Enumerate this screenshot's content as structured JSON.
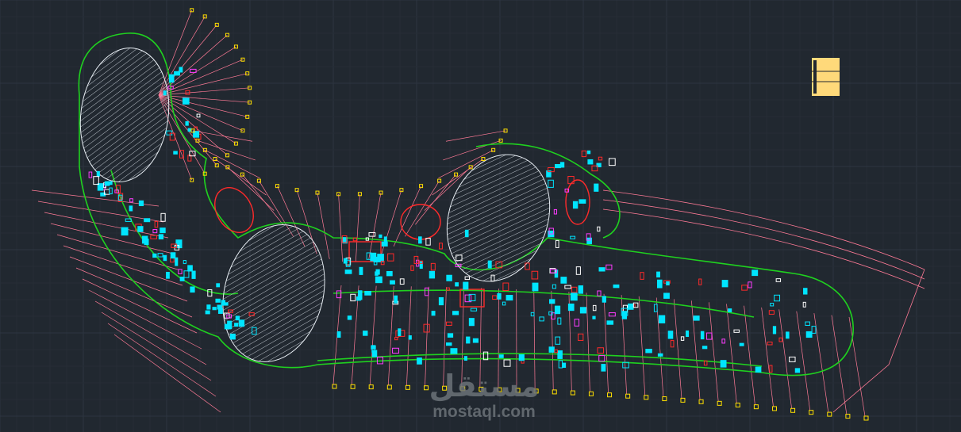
{
  "viewport": {
    "background": "#212830",
    "grid_minor": "#262d36",
    "grid_major": "#2d3540"
  },
  "colors": {
    "outline": "#1fd11f",
    "radial": "#ff7a96",
    "columns": "#00e5ff",
    "markers": "#ffe000",
    "hatch": "#b9c0c8",
    "walls": "#ff2a2a",
    "magenta": "#ff3cff",
    "titleblock": "#ffd97a"
  },
  "watermark": {
    "arabic": "مستقل",
    "latin": "mostaql.com"
  }
}
